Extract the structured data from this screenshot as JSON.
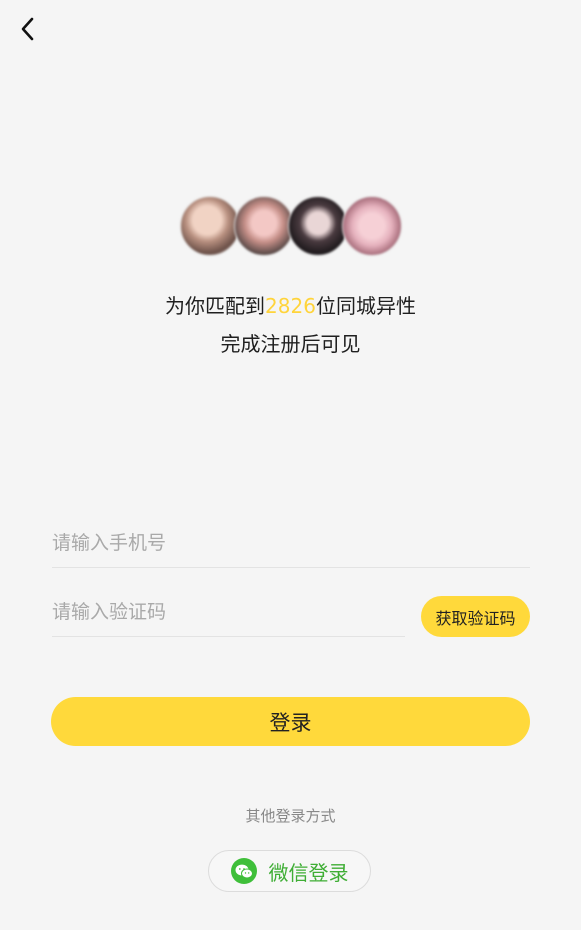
{
  "nav": {
    "back_icon": "chevron-left-icon"
  },
  "match": {
    "prefix": "为你匹配到",
    "count": "2826",
    "suffix": "位同城异性",
    "subtitle": "完成注册后可见"
  },
  "form": {
    "phone_placeholder": "请输入手机号",
    "code_placeholder": "请输入验证码",
    "get_code_label": "获取验证码",
    "login_label": "登录"
  },
  "other_login": {
    "label": "其他登录方式",
    "wechat_label": "微信登录",
    "wechat_icon": "wechat-icon"
  },
  "colors": {
    "accent": "#ffd93b",
    "count": "#ffd43b",
    "wechat": "#3fbf3a",
    "background": "#f5f5f5"
  }
}
